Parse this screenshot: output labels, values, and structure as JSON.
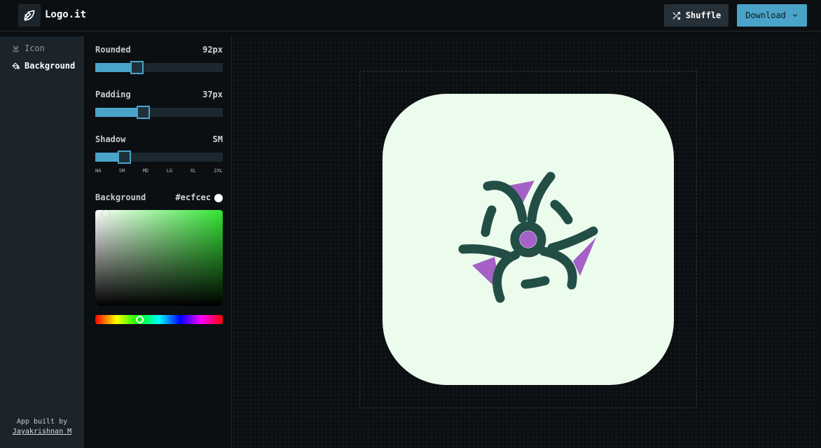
{
  "header": {
    "title": "Logo.it",
    "shuffle_label": "Shuffle",
    "download_label": "Download",
    "logo_icon": "leaf-icon",
    "shuffle_icon": "shuffle-icon",
    "download_icon": "chevron-down-icon"
  },
  "sidebar": {
    "items": [
      {
        "label": "Icon",
        "icon": "biohazard-icon",
        "active": false
      },
      {
        "label": "Background",
        "icon": "paint-bucket-icon",
        "active": true
      }
    ],
    "credit_line1": "App built by",
    "credit_author": "Jayakrishnan M"
  },
  "settings": {
    "rounded": {
      "label": "Rounded",
      "value": "92px",
      "fraction": 0.33
    },
    "padding": {
      "label": "Padding",
      "value": "37px",
      "fraction": 0.38
    },
    "shadow": {
      "label": "Shadow",
      "value": "SM",
      "fraction": 0.23,
      "ticks": [
        "NA",
        "SM",
        "MD",
        "LG",
        "XL",
        "2XL"
      ]
    },
    "background": {
      "label": "Background",
      "value": "#ecfcec"
    }
  },
  "colors": {
    "accent": "#4aa3c9",
    "tile_background": "#ecfcec",
    "icon_stroke": "#234e46",
    "icon_fill": "#a561c7"
  },
  "canvas": {
    "icon": "biohazard-icon"
  }
}
